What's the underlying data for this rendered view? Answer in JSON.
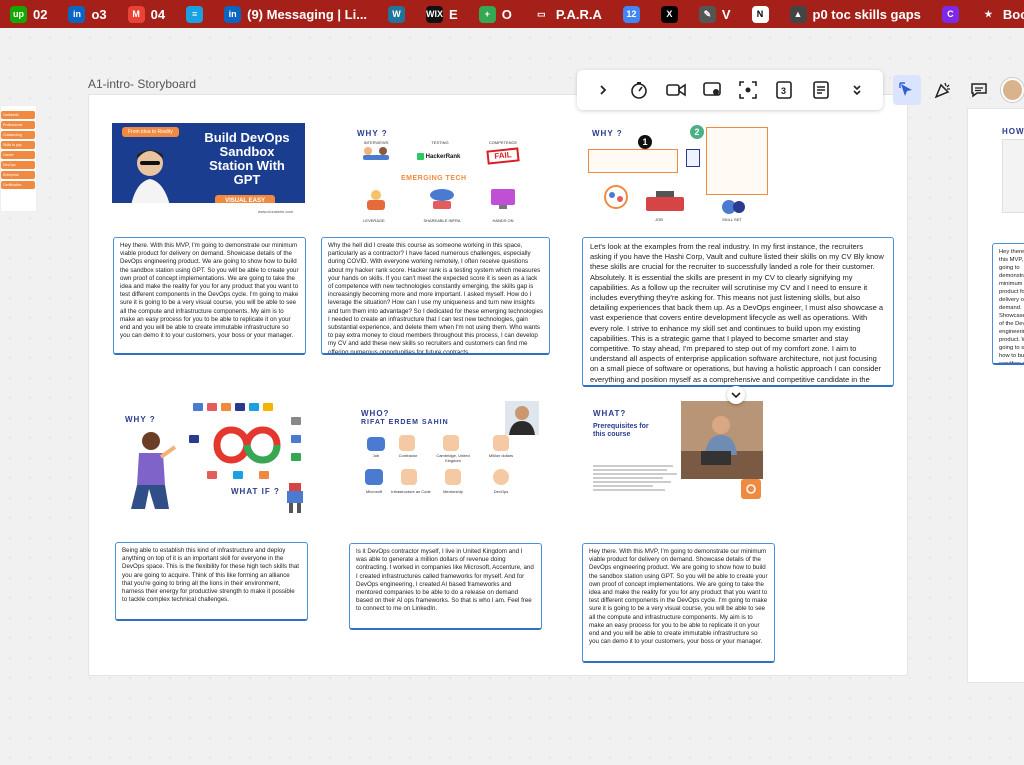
{
  "bookmarks": [
    {
      "icon": "upwork-icon",
      "glyph": "up",
      "color": "#14a800",
      "label": "02"
    },
    {
      "icon": "linkedin-icon",
      "glyph": "in",
      "color": "#0a66c2",
      "label": "o3"
    },
    {
      "icon": "gmail-icon",
      "glyph": "M",
      "color": "#ea4335",
      "label": "04"
    },
    {
      "icon": "bookmark-app-icon",
      "glyph": "≡",
      "color": "#1ba1e2",
      "label": ""
    },
    {
      "icon": "linkedin-icon",
      "glyph": "in",
      "color": "#0a66c2",
      "label": "(9) Messaging | Li..."
    },
    {
      "icon": "wordpress-icon",
      "glyph": "W",
      "color": "#21759b",
      "label": ""
    },
    {
      "icon": "wix-icon",
      "glyph": "WIX",
      "color": "#111111",
      "label": "E"
    },
    {
      "icon": "plus-app-icon",
      "glyph": "+",
      "color": "#34a853",
      "label": "O"
    },
    {
      "icon": "folder-icon",
      "glyph": "▭",
      "color": "transparent",
      "label": "P.A.R.A"
    },
    {
      "icon": "calendar-icon",
      "glyph": "12",
      "color": "#4285f4",
      "label": ""
    },
    {
      "icon": "x-icon",
      "glyph": "X",
      "color": "#000000",
      "label": ""
    },
    {
      "icon": "pen-icon",
      "glyph": "✎",
      "color": "#555555",
      "label": "V"
    },
    {
      "icon": "notion-icon",
      "glyph": "N",
      "color": "#ffffff",
      "label": ""
    },
    {
      "icon": "cap-icon",
      "glyph": "▲",
      "color": "#444444",
      "label": "p0 toc skills gaps"
    },
    {
      "icon": "canva-icon",
      "glyph": "C",
      "color": "#7d2ae8",
      "label": ""
    },
    {
      "icon": "star-icon",
      "glyph": "★",
      "color": "transparent",
      "label": "Bookmarks"
    }
  ],
  "frame": {
    "title": "A1-intro- Storyboard"
  },
  "frame2": {
    "heading": "HOW"
  },
  "tags": [
    "Cadidants",
    "Professional",
    "Outstanding",
    "Skills to pay",
    "Career",
    "DevOps",
    "Enterprise Management",
    "Certification"
  ],
  "cover": {
    "badge": "From idea to Reality",
    "headline": "Build DevOps Sandbox Station With GPT",
    "visual": "VISUAL EASY",
    "footer": "www.cloudwire.com"
  },
  "scene2": {
    "why": "WHY ?",
    "labels": [
      "INTERVIEWS",
      "TESTING",
      "COMPETENCE",
      "LEVERAGE",
      "SHAREABLE INFRA",
      "HANDS ON"
    ],
    "hackerrank": "HackerRank",
    "fail": "FAIL",
    "emerging": "EMERGING TECH"
  },
  "scene3": {
    "why": "WHY ?",
    "badge1": "1",
    "badge2": "2",
    "labels": [
      "JOB",
      "SKILL SET"
    ]
  },
  "scene4": {
    "why": "WHY ?",
    "whatif": "WHAT IF ?"
  },
  "scene5": {
    "who": "WHO?",
    "name": "RIFAT ERDEM SAHIN",
    "labels": [
      "Job",
      "Contractor",
      "Cambridge, United Kingdom",
      "Million dollars",
      "Microsoft",
      "Infrastructure as Code",
      "Mentorship",
      "DevOps"
    ]
  },
  "scene6": {
    "what": "WHAT?",
    "title": "Prerequisites for this course"
  },
  "texts": {
    "t1": "Hey there. With this MVP, I'm going to demonstrate our minimum viable product for delivery on demand. Showcase details of the DevOps engineering product. We are going to show how to build the sandbox station using GPT. So you will be able to create your own proof of concept implementations. We are going to take the idea and make the reality for you for any product that you want to test different components in the DevOps cycle. I'm going to make sure it is going to be a very visual course, you will be able to see all the compute and infrastructure components. My aim is to make an easy process for you to be able to replicate it on your end and you will be able to create immutable infrastructure so you can demo it to your customers, your boss or your manager.",
    "t2": "Why the hell did I create this course as someone working in this space, particularly as a contractor? I have faced numerous challenges, especially during COVID. With everyone working remotely, I often receive questions about my hacker rank score. Hacker rank is a testing system which measures your hands on skills. If you can't meet the expected score it is seen as a lack of competence with new technologies constantly emerging, the skills gap is increasingly becoming more and more important. I asked myself. How do I leverage the situation? How can I use my uniqueness and turn new insights and turn them into advantage? So I dedicated for these emerging technologies I needed to create an infrastructure that I can test new technologies, gain substantial experience, and delete them when I'm not using them. Who wants to pay extra money to cloud members throughout this process, I can develop my CV and add these new skills so recruiters and customers can find me offering numerous opportunities for future contracts.",
    "t3": "Let's look at the examples from the real industry. In my first instance, the recruiters asking if you have the Hashi Corp, Vault and culture listed their skills on my CV Bly know these skills are crucial for the recruiter to successfully landed a role for their customer. Absolutely. It is essential the skills are present in my CV to clearly signifying my capabilities. As a follow up the recruiter will scrutinise my CV and I need to ensure it includes everything they're asking for. This means not just listening skills, but also detailing experiences that back them up. As a DevOps engineer, I must also showcase a vast experience that covers entire development lifecycle as well as operations. With every role. I strive to enhance my skill set and continues to build upon my existing capabilities. This is a strategic game that I played to become smarter and stay competitive. To stay ahead, I'm prepared to step out of my comfort zone. I aim to understand all aspects of enterprise application software architecture, not just focusing on a small piece of software or operations, but having a holistic approach I can consider everything and position myself as a comprehensive and competitive candidate in the field.",
    "t4": "Being able to establish this kind of infrastructure and deploy anything on top of it is an important skill for everyone in the DevOps space. This is the flexibility for these high tech skills that you are going to acquire. Think of this like forming an alliance that you're going to bring all the lions in their environment, harness their energy for productive strength to make it possible to tackle complex technical challenges.",
    "t5": "Is it DevOps contractor myself, I live in United Kingdom and I was able to generate a million dollars of revenue doing contracting. I worked in companies like Microsoft, Accenture, and I created infrastructures called frameworks for myself. And for DevOps engineering, I created AI based frameworks and mentored companies to be able to do a release on demand based on their AI ops frameworks. So that is who I am. Feel free to connect to me on LinkedIn.",
    "t6": "Hey there. With this MVP, I'm going to demonstrate our minimum viable product for delivery on demand. Showcase details of the DevOps engineering product. We are going to show how to build the sandbox station using GPT. So you will be able to create your own proof of concept implementations. We are going to take the idea and make the reality for you for any product that you want to test different components in the DevOps cycle. I'm going to make sure it is going to be a very visual course, you will be able to see all the compute and infrastructure components. My aim is to make an easy process for you to be able to replicate it on your end and you will be able to create immutable infrastructure so you can demo it to your customers, your boss or your manager.",
    "t7": "Hey there. With this MVP, I'm going to demonstrate our minimum viable product for delivery on demand. Showcase details of the DevOps engineering product. We are going to show how to build the sandbox station using GPT. So you will be able to create your own proof of concept implementations. We are going to take the idea and make the reality for you for any product that you want to test different components in the DevOps cycle. I'm going to make sure it is going to be a very visual course, you will be able to see all the compute and infrastructure components. My aim is to make an easy process for you to be able to replicate it on your end and you will be able to create immutable infrastructure so you can demo it to your customers, your boss or your manager."
  },
  "toolbar": {
    "buttons": [
      "chevron-right-icon",
      "timer-icon",
      "video-icon",
      "screen-record-icon",
      "focus-icon",
      "sticky-number-icon",
      "notes-icon",
      "chevron-double-down-icon"
    ]
  },
  "toolbar2": {
    "buttons": [
      "select-cursor-icon",
      "celebrate-icon",
      "comment-icon"
    ]
  }
}
